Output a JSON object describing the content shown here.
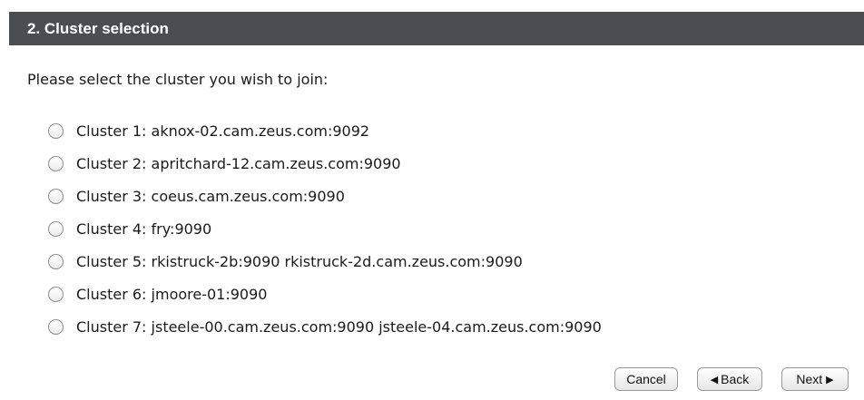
{
  "header": {
    "title": "2. Cluster selection"
  },
  "prompt": "Please select the cluster you wish to join:",
  "clusters": [
    {
      "label": "Cluster 1: aknox-02.cam.zeus.com:9092",
      "selected": false
    },
    {
      "label": "Cluster 2: apritchard-12.cam.zeus.com:9090",
      "selected": false
    },
    {
      "label": "Cluster 3: coeus.cam.zeus.com:9090",
      "selected": false
    },
    {
      "label": "Cluster 4: fry:9090",
      "selected": false
    },
    {
      "label": "Cluster 5: rkistruck-2b:9090 rkistruck-2d.cam.zeus.com:9090",
      "selected": false
    },
    {
      "label": "Cluster 6: jmoore-01:9090",
      "selected": false
    },
    {
      "label": "Cluster 7: jsteele-00.cam.zeus.com:9090 jsteele-04.cam.zeus.com:9090",
      "selected": false
    }
  ],
  "buttons": {
    "cancel_label": "Cancel",
    "back_label": "Back",
    "back_icon": "triangle-left-icon",
    "next_label": "Next",
    "next_icon": "triangle-right-icon"
  },
  "colors": {
    "header_bg": "#4a4d52",
    "header_text": "#ffffff"
  }
}
